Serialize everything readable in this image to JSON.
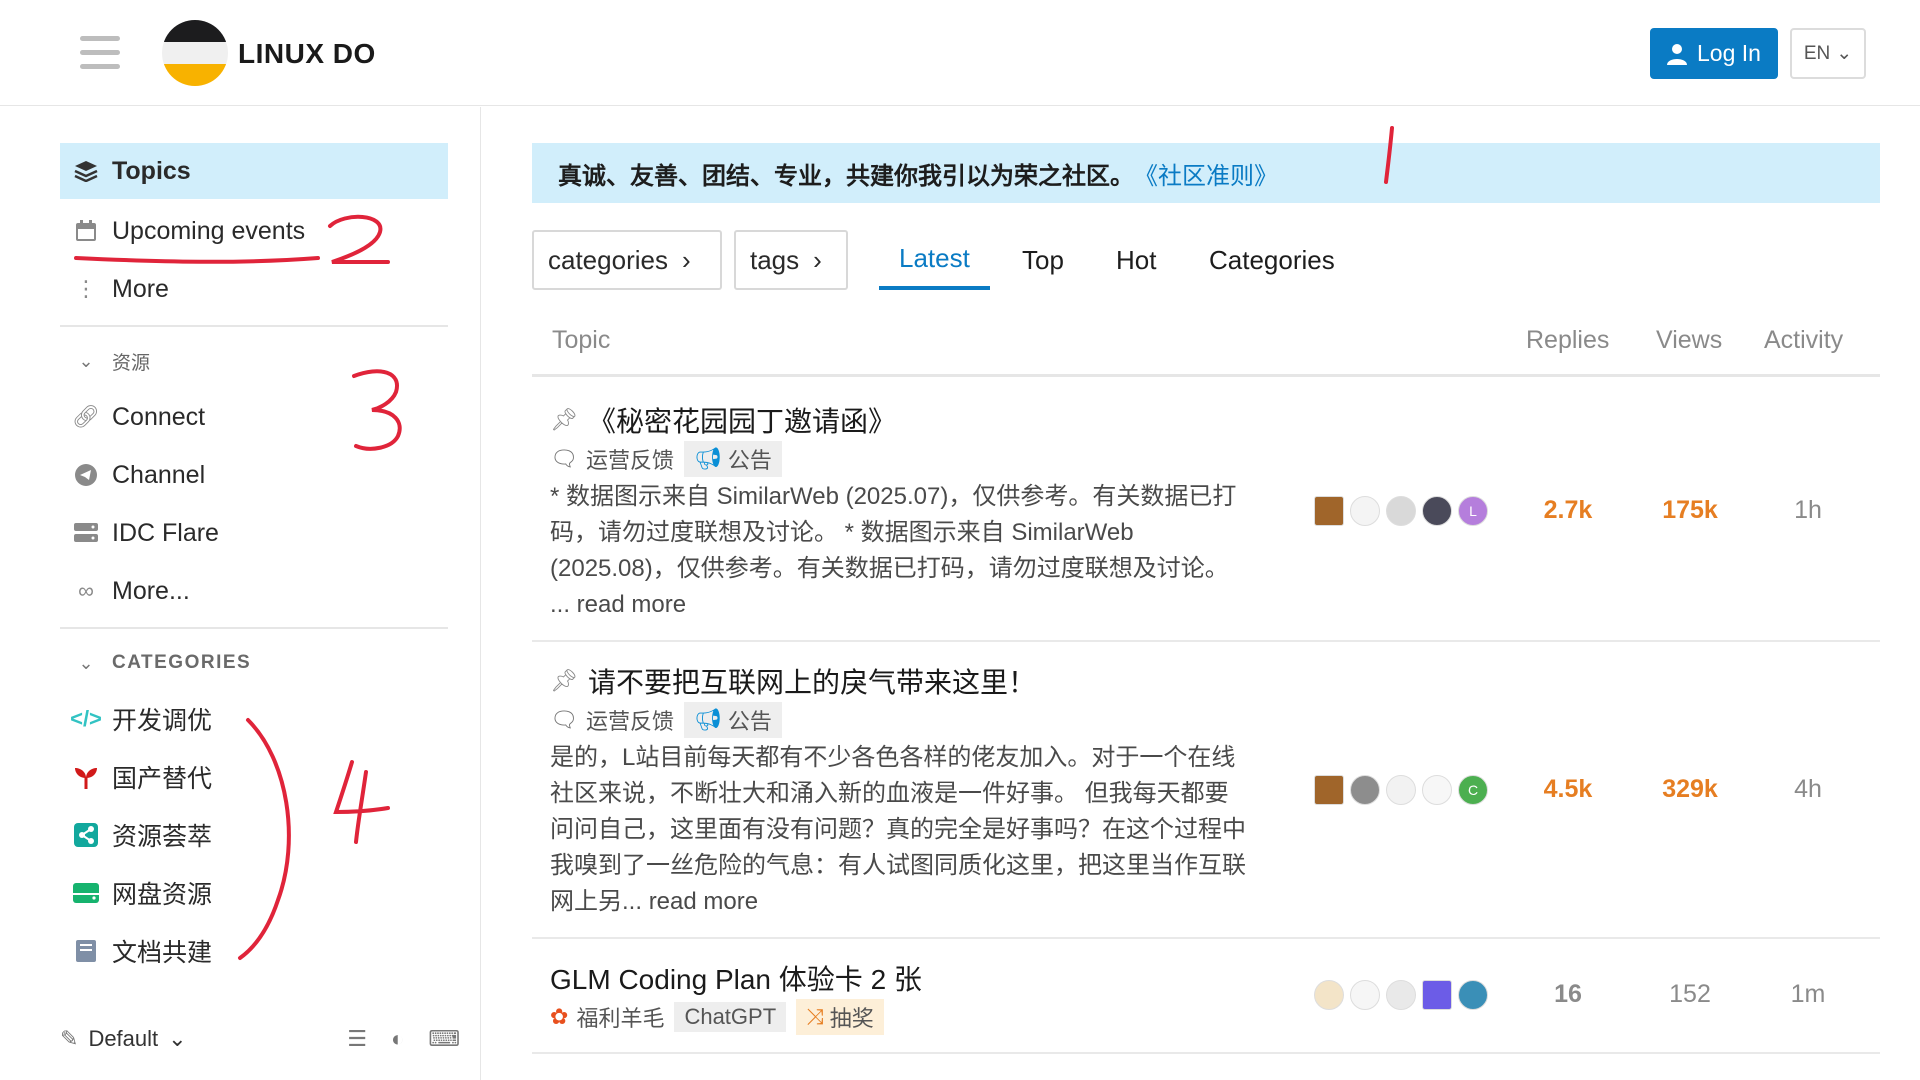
{
  "header": {
    "brand": "LINUX DO",
    "login_label": "Log In",
    "lang_label": "EN"
  },
  "sidebar": {
    "top_items": [
      {
        "label": "Topics",
        "icon": "layers-icon"
      },
      {
        "label": "Upcoming events",
        "icon": "calendar-icon"
      },
      {
        "label": "More",
        "icon": "ellipsis-vertical-icon"
      }
    ],
    "resources_title": "资源",
    "resources": [
      {
        "label": "Connect",
        "icon": "link-icon"
      },
      {
        "label": "Channel",
        "icon": "telegram-icon"
      },
      {
        "label": "IDC Flare",
        "icon": "server-icon"
      },
      {
        "label": "More...",
        "icon": "infinity-icon"
      }
    ],
    "categories_title": "CATEGORIES",
    "categories": [
      {
        "label": "开发调优",
        "icon": "code-icon",
        "color": "#32c3c3"
      },
      {
        "label": "国产替代",
        "icon": "sprout-icon",
        "color": "#d11a1a"
      },
      {
        "label": "资源荟萃",
        "icon": "share-icon",
        "color": "#12a89d"
      },
      {
        "label": "网盘资源",
        "icon": "drive-icon",
        "color": "#16b36e"
      },
      {
        "label": "文档共建",
        "icon": "book-icon",
        "color": "#7f8fa6"
      }
    ],
    "footer_theme": "Default"
  },
  "banner": {
    "text": "真诚、友善、团结、专业，共建你我引以为荣之社区。",
    "link": "《社区准则》"
  },
  "filters": {
    "categories": "categories",
    "tags": "tags"
  },
  "tabs": [
    "Latest",
    "Top",
    "Hot",
    "Categories"
  ],
  "table": {
    "headers": {
      "topic": "Topic",
      "replies": "Replies",
      "views": "Views",
      "activity": "Activity"
    },
    "rows": [
      {
        "pinned": true,
        "title": "《秘密花园园丁邀请函》",
        "category": "运营反馈",
        "tags": [
          "公告"
        ],
        "excerpt_lines": [
          "* 数据图示来自 SimilarWeb (2025.07)，仅供参考。有关数据已打",
          "码，请勿过度联想及讨论。 * 数据图示来自 SimilarWeb",
          "(2025.08)，仅供参考。有关数据已打码，请勿过度联想及讨论。"
        ],
        "read_more": "... read more",
        "replies": "2.7k",
        "views": "175k",
        "activity": "1h"
      },
      {
        "pinned": true,
        "title": "请不要把互联网上的戾气带来这里！",
        "category": "运营反馈",
        "tags": [
          "公告"
        ],
        "excerpt_lines": [
          "是的，L站目前每天都有不少各色各样的佬友加入。对于一个在线",
          "社区来说，不断壮大和涌入新的血液是一件好事。 但我每天都要",
          "问问自己，这里面有没有问题？真的完全是好事吗？在这个过程中",
          "我嗅到了一丝危险的气息：有人试图同质化这里，把这里当作互联"
        ],
        "excerpt_last": "网上另...",
        "read_more": "read more",
        "replies": "4.5k",
        "views": "329k",
        "activity": "4h"
      },
      {
        "pinned": false,
        "title": "GLM Coding Plan 体验卡 2 张",
        "category": "福利羊毛",
        "tags": [
          "ChatGPT",
          "抽奖"
        ],
        "replies": "16",
        "views": "152",
        "activity": "1m"
      }
    ]
  },
  "annotations": [
    "1",
    "2",
    "3",
    "4"
  ]
}
